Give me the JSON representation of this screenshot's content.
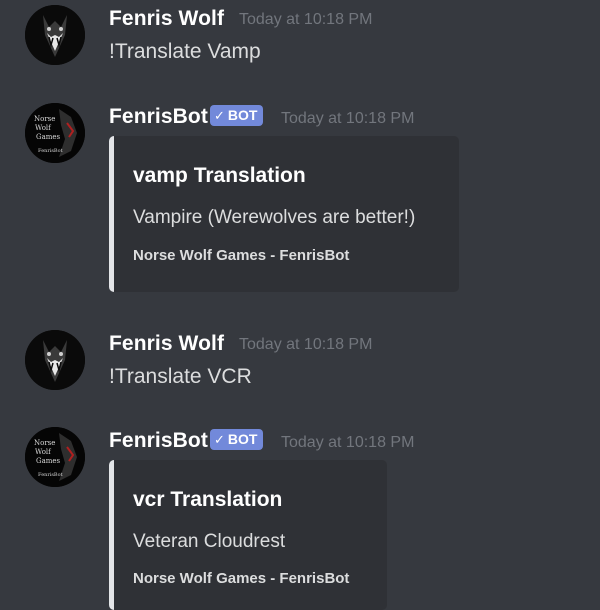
{
  "messages": [
    {
      "author": "Fenris Wolf",
      "timestamp": "Today at 10:18 PM",
      "content": "!Translate Vamp",
      "avatar_icon": "wolf-howl-avatar"
    },
    {
      "author": "FenrisBot",
      "bot_tag": "BOT",
      "bot_check": "✓",
      "timestamp": "Today at 10:18 PM",
      "avatar_icon": "norse-wolf-games-logo",
      "avatar_text": [
        "Norse",
        "Wolf",
        "Games",
        "FenrisBot"
      ],
      "embed": {
        "title": "vamp Translation",
        "description": "Vampire (Werewolves are better!)",
        "footer": "Norse Wolf Games - FenrisBot"
      }
    },
    {
      "author": "Fenris Wolf",
      "timestamp": "Today at 10:18 PM",
      "content": "!Translate VCR",
      "avatar_icon": "wolf-howl-avatar"
    },
    {
      "author": "FenrisBot",
      "bot_tag": "BOT",
      "bot_check": "✓",
      "timestamp": "Today at 10:18 PM",
      "avatar_icon": "norse-wolf-games-logo",
      "avatar_text": [
        "Norse",
        "Wolf",
        "Games",
        "FenrisBot"
      ],
      "embed": {
        "title": "vcr Translation",
        "description": "Veteran Cloudrest",
        "footer": "Norse Wolf Games - FenrisBot"
      }
    }
  ],
  "colors": {
    "background": "#36393f",
    "embed_background": "#2f3136",
    "embed_border": "#e3e5e8",
    "bot_tag": "#7289da",
    "timestamp": "#72767d",
    "text": "#dcddde",
    "username": "#ffffff"
  }
}
